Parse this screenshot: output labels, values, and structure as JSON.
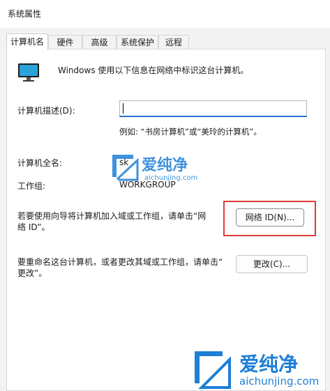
{
  "window": {
    "title": "系统属性"
  },
  "tabs": [
    {
      "label": "计算机名"
    },
    {
      "label": "硬件"
    },
    {
      "label": "高级"
    },
    {
      "label": "系统保护"
    },
    {
      "label": "远程"
    }
  ],
  "computer_name_tab": {
    "intro": "Windows 使用以下信息在网络中标识这台计算机。",
    "description_label": "计算机描述(D):",
    "description_value": "",
    "example": "例如: “书房计算机”或“美玲的计算机”。",
    "full_name_label": "计算机全名:",
    "full_name_value": "sk",
    "workgroup_label": "工作组:",
    "workgroup_value": "WORKGROUP",
    "network_id_text_line1": "若要使用向导将计算机加入域或工作组，请单击“网",
    "network_id_text_line2": "络 ID”。",
    "network_id_button": "网络 ID(N)...",
    "rename_text_line1": "要重命名这台计算机，或者更改其域或工作组，请单击“",
    "rename_text_line2": "更改”。",
    "change_button": "更改(C)..."
  },
  "watermark": {
    "brand": "爱纯净",
    "url": "aichunjing.com"
  },
  "colors": {
    "highlight_box": "#e03a3a",
    "input_focus": "#2a6fd1",
    "watermark": "#1e7fd6"
  }
}
